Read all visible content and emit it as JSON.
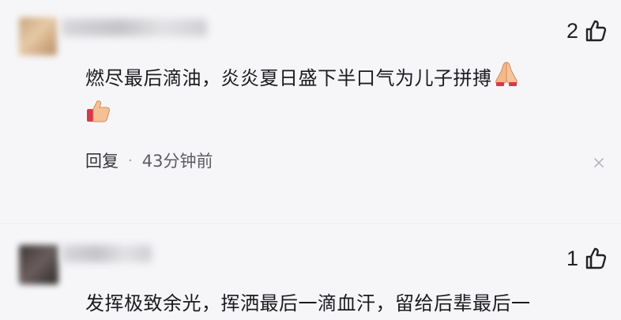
{
  "comments": [
    {
      "likes": "2",
      "text": "燃尽最后滴油，炎炎夏日盛下半口气为儿子拼搏",
      "emojis": [
        "folded-hands",
        "thumbs-up"
      ],
      "reply_label": "回复",
      "separator": "·",
      "time": "43分钟前"
    },
    {
      "likes": "1",
      "text": "发挥极致余光，挥洒最后一滴血汗，留给后辈最后一"
    }
  ],
  "icons": {
    "like": "thumbs-up-outline-icon",
    "close": "close-icon",
    "emoji_pray": "folded-hands-icon",
    "emoji_thumb": "thumbs-up-emoji-icon"
  },
  "colors": {
    "background": "#f6f6f8",
    "text": "#1b1b20",
    "secondary_text": "#5c5c64"
  }
}
